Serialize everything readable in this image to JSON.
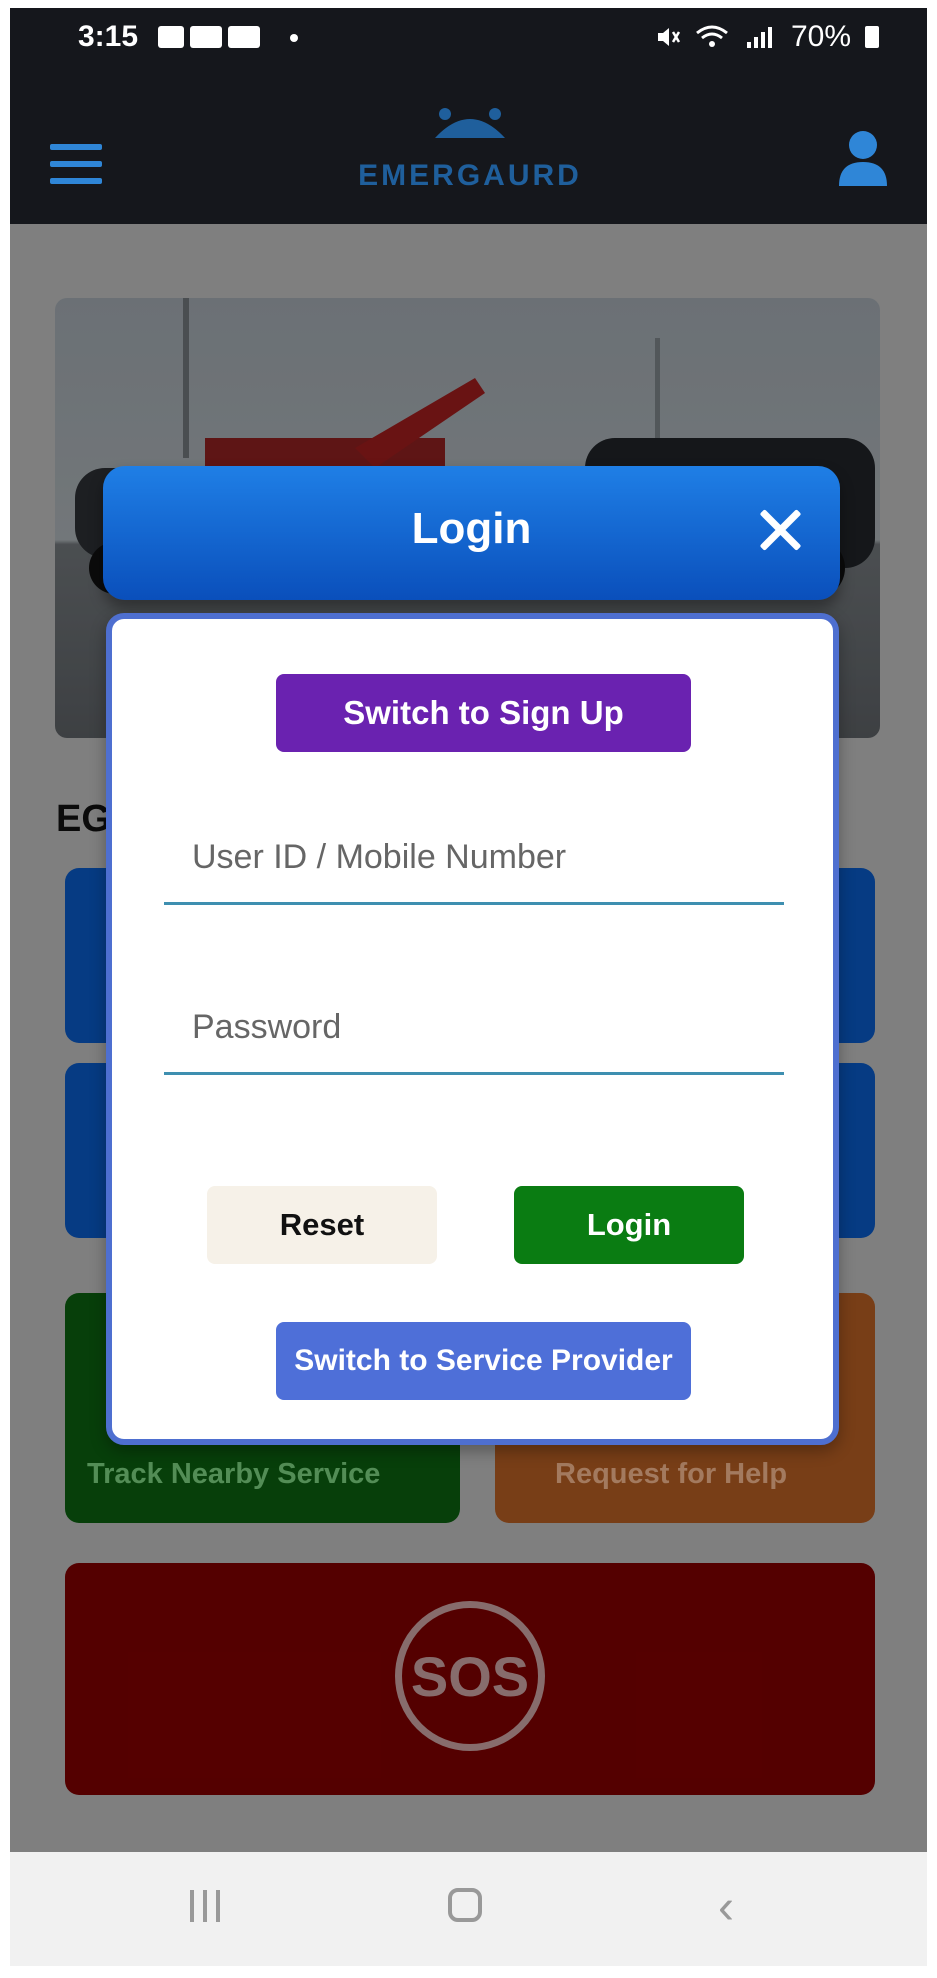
{
  "status_bar": {
    "time": "3:15",
    "battery": "70%"
  },
  "app_bar": {
    "brand": "EMERGAURD",
    "tagline": ""
  },
  "background": {
    "heading": "EG",
    "tiles": [
      {
        "label": "Track Nearby Service",
        "color": "#0b5d10"
      },
      {
        "label": "Request for Help",
        "color": "#b25c22"
      }
    ],
    "sos_label": "SOS"
  },
  "login_modal": {
    "title": "Login",
    "switch_signup": "Switch to Sign Up",
    "user_placeholder": "User ID / Mobile Number",
    "password_placeholder": "Password",
    "reset": "Reset",
    "login": "Login",
    "switch_provider": "Switch to Service Provider"
  },
  "colors": {
    "header_blue": "#1f7fe6",
    "signup_purple": "#6a22b0",
    "login_green": "#0a7c12",
    "provider_blue": "#4e6fd8",
    "reset_beige": "#f6f1e8",
    "sos_red": "#7d0000"
  }
}
